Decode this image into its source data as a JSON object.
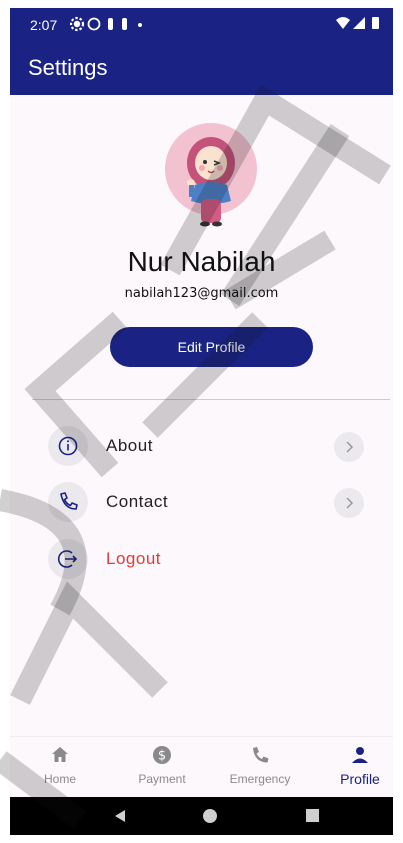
{
  "status_bar": {
    "time": "2:07",
    "left_icons": [
      "gear-icon",
      "pinwheel-icon",
      "notification-icon",
      "notification-icon",
      "dot-icon"
    ],
    "right_icons": [
      "wifi-icon",
      "signal-icon",
      "battery-icon"
    ]
  },
  "app_bar": {
    "title": "Settings"
  },
  "profile": {
    "name": "Nur Nabilah",
    "email": "nabilah123@gmail.com",
    "edit_button_label": "Edit Profile"
  },
  "menu": {
    "items": [
      {
        "label": "About",
        "icon": "info-icon",
        "has_chevron": true
      },
      {
        "label": "Contact",
        "icon": "phone-icon",
        "has_chevron": true
      },
      {
        "label": "Logout",
        "icon": "logout-icon",
        "has_chevron": false,
        "color": "#e53935"
      }
    ]
  },
  "bottom_nav": {
    "items": [
      {
        "label": "Home",
        "icon": "home-icon",
        "active": false
      },
      {
        "label": "Payment",
        "icon": "dollar-icon",
        "active": false
      },
      {
        "label": "Emergency",
        "icon": "phone-icon",
        "active": false
      },
      {
        "label": "Profile",
        "icon": "person-icon",
        "active": true
      }
    ]
  },
  "colors": {
    "primary": "#1a2384",
    "logout": "#e53935",
    "background": "#fdf8fc"
  }
}
